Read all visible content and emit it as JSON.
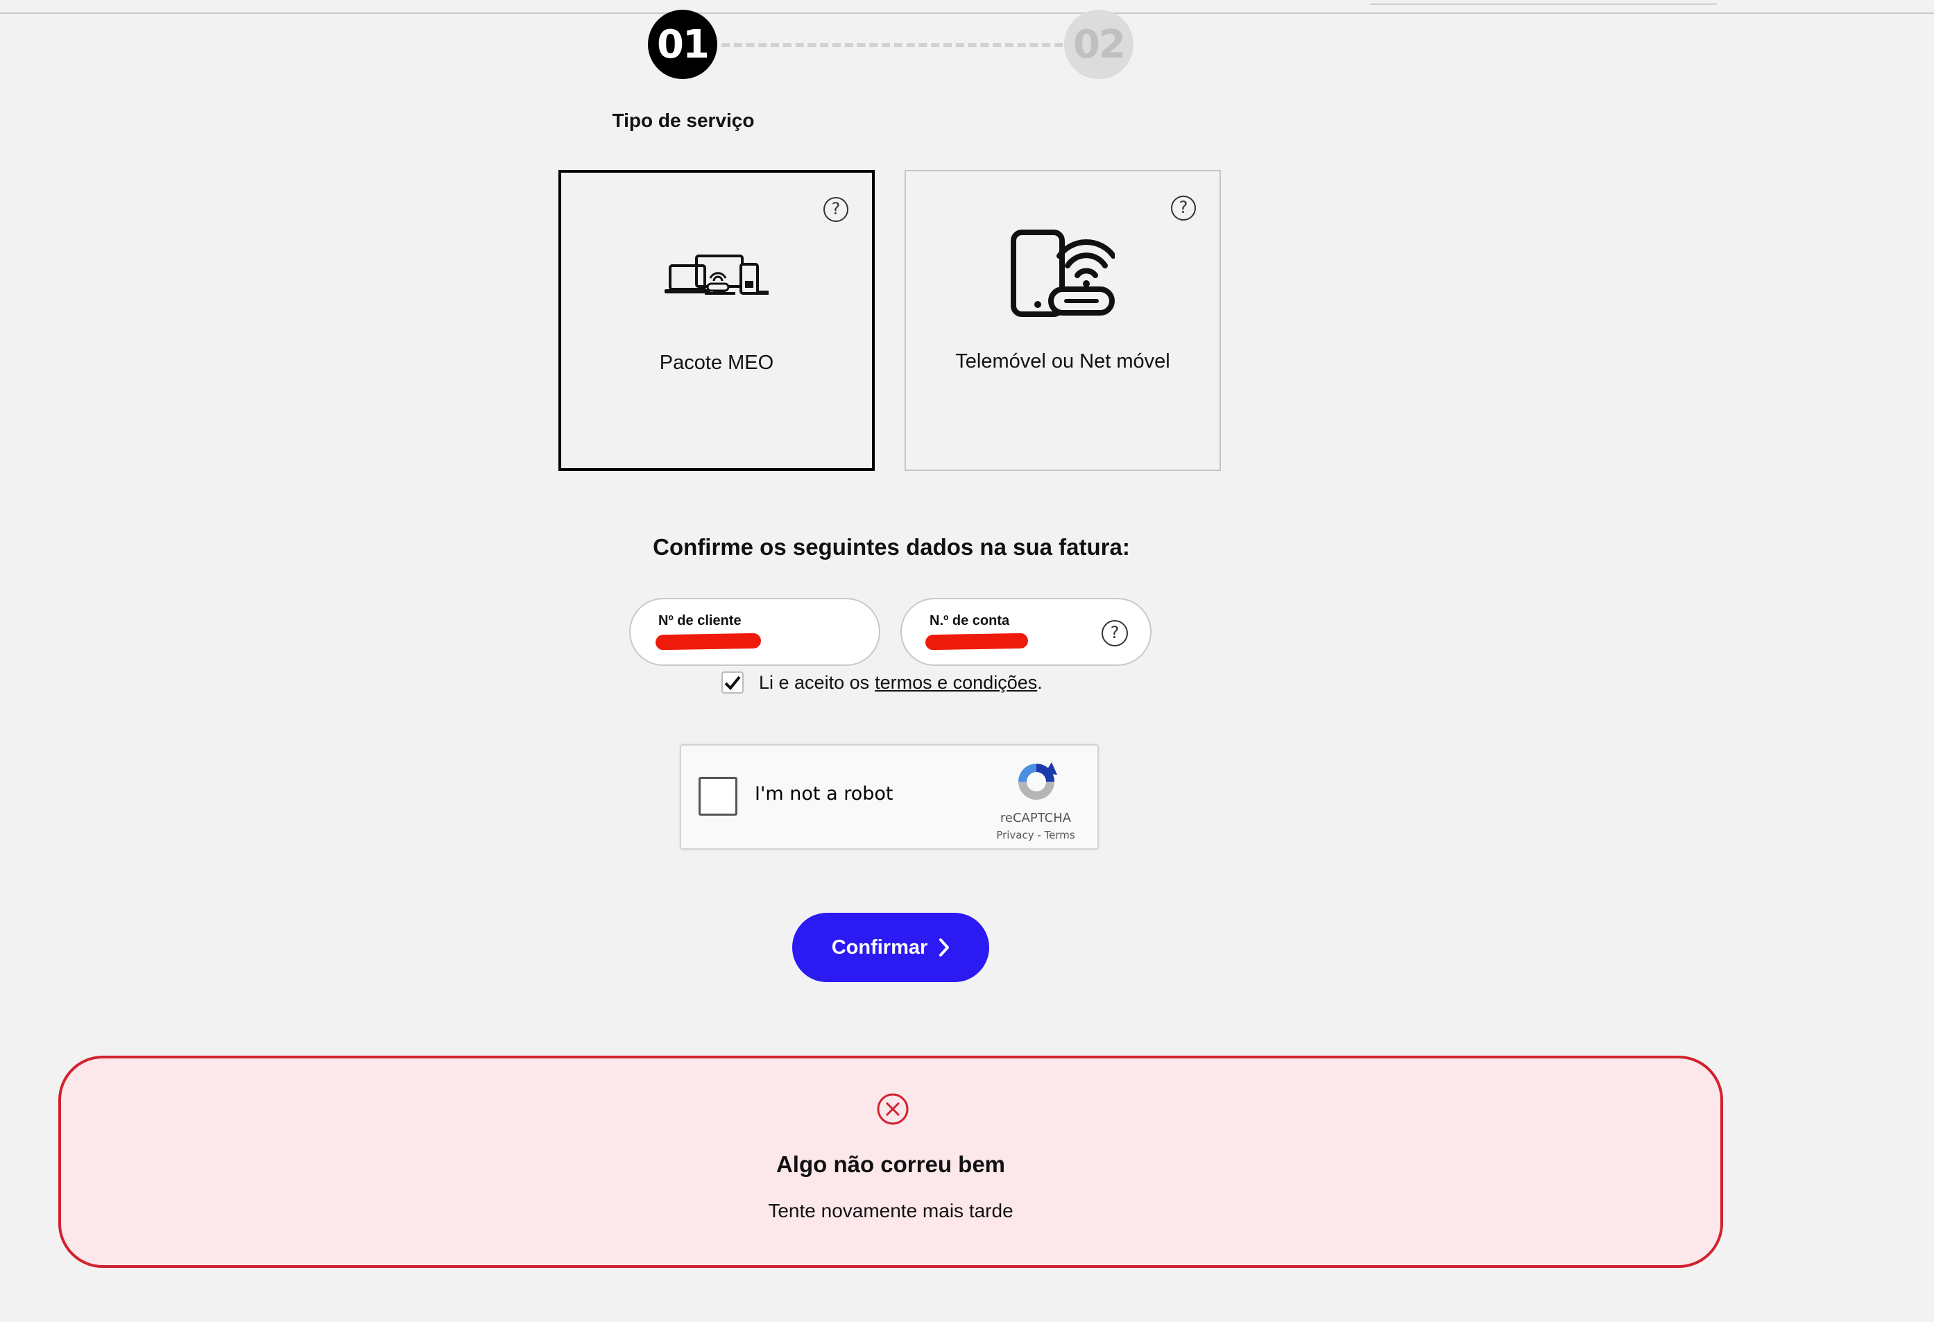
{
  "stepper": {
    "step1_number": "01",
    "step2_number": "02",
    "step1_label": "Tipo de serviço"
  },
  "services": [
    {
      "label": "Pacote MEO",
      "icon": "devices-icon",
      "selected": true
    },
    {
      "label": "Telemóvel ou Net móvel",
      "icon": "phone-router-icon",
      "selected": false
    }
  ],
  "form": {
    "heading": "Confirme os seguintes dados na sua fatura:",
    "client_label": "Nº de cliente",
    "account_label": "N.º de conta",
    "terms_prefix": "Li e aceito os",
    "terms_link": "termos e condições",
    "terms_suffix": ".",
    "terms_checked": true
  },
  "recaptcha": {
    "label": "I'm not a robot",
    "brand": "reCAPTCHA",
    "links": "Privacy - Terms"
  },
  "confirm_button": "Confirmar",
  "error": {
    "title": "Algo não correu bem",
    "message": "Tente novamente mais tarde"
  },
  "colors": {
    "accent": "#2b1af2",
    "error_border": "#d0232f",
    "error_bg": "#fce8eb",
    "redaction": "#ee1b0c"
  }
}
